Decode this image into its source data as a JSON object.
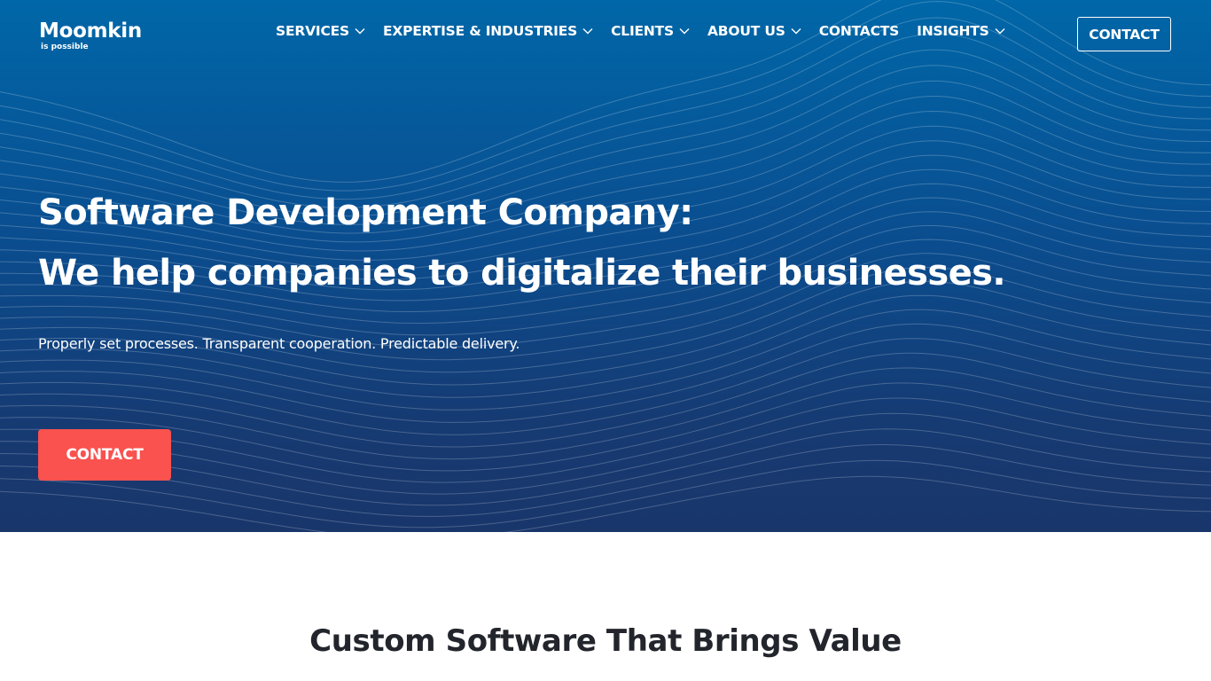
{
  "brand": {
    "name": "Moomkin",
    "tagline": "is possible"
  },
  "nav": {
    "items": [
      {
        "label": "SERVICES",
        "has_dropdown": true
      },
      {
        "label": "EXPERTISE & INDUSTRIES",
        "has_dropdown": true
      },
      {
        "label": "CLIENTS",
        "has_dropdown": true
      },
      {
        "label": "ABOUT US",
        "has_dropdown": true
      },
      {
        "label": "CONTACTS",
        "has_dropdown": false
      },
      {
        "label": "INSIGHTS",
        "has_dropdown": true
      }
    ],
    "contact_button": "CONTACT"
  },
  "hero": {
    "title_line1": "Software Development Company:",
    "title_line2": "We help companies to digitalize their businesses.",
    "subtitle": "Properly set processes. Transparent cooperation. Predictable delivery.",
    "cta_label": "CONTACT"
  },
  "section": {
    "title": "Custom Software That Brings Value"
  },
  "colors": {
    "hero_top": "#0067a8",
    "hero_bottom": "#19366b",
    "cta": "#f9524f",
    "heading_dark": "#22252b"
  }
}
